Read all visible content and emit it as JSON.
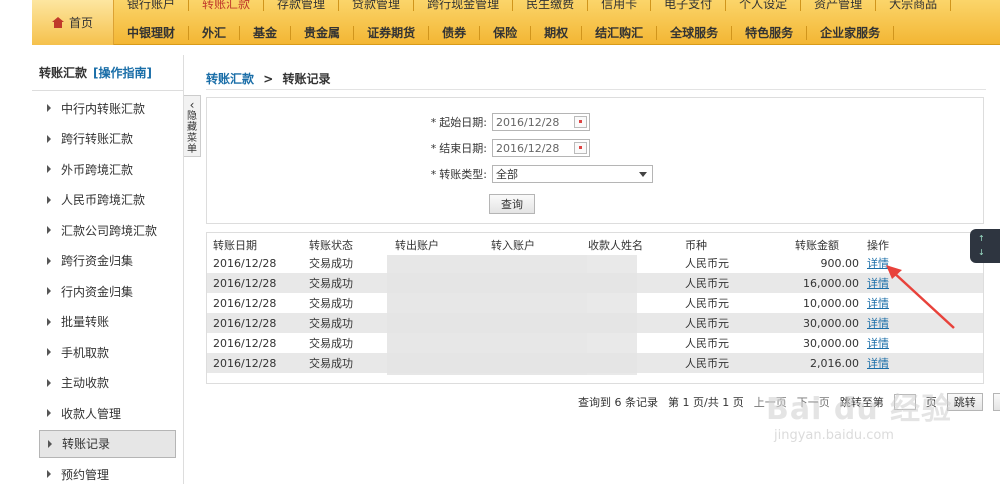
{
  "topnav": {
    "home_label": "首页",
    "row1": [
      "银行账户",
      "转账汇款",
      "存款管理",
      "贷款管理",
      "跨行现金管理",
      "民生缴费",
      "信用卡",
      "电子支付",
      "个人设定",
      "资产管理",
      "大宗商品"
    ],
    "row2": [
      "中银理财",
      "外汇",
      "基金",
      "贵金属",
      "证券期货",
      "债券",
      "保险",
      "期权",
      "结汇购汇",
      "全球服务",
      "特色服务",
      "企业家服务"
    ],
    "active": "转账汇款"
  },
  "sidebar": {
    "title": "转账汇款",
    "guide": "[操作指南]",
    "items": [
      "中行内转账汇款",
      "跨行转账汇款",
      "外币跨境汇款",
      "人民币跨境汇款",
      "汇款公司跨境汇款",
      "跨行资金归集",
      "行内资金归集",
      "批量转账",
      "手机取款",
      "主动收款",
      "收款人管理",
      "转账记录",
      "预约管理"
    ],
    "active": "转账记录"
  },
  "collapse_tab": {
    "chevron": "‹",
    "label": [
      "隐",
      "藏",
      "菜",
      "单"
    ]
  },
  "breadcrumb": {
    "parent": "转账汇款",
    "sep": ">",
    "current": "转账记录"
  },
  "form": {
    "start_label": "起始日期:",
    "start_value": "2016/12/28",
    "end_label": "结束日期:",
    "end_value": "2016/12/28",
    "type_label": "转账类型:",
    "type_value": "全部",
    "query_button": "查询"
  },
  "table": {
    "headers": [
      "转账日期",
      "转账状态",
      "转出账户",
      "转入账户",
      "收款人姓名",
      "币种",
      "转账金额",
      "操作"
    ],
    "rows": [
      {
        "date": "2016/12/28",
        "status": "交易成功",
        "currency": "人民币元",
        "amount": "900.00",
        "op": "详情"
      },
      {
        "date": "2016/12/28",
        "status": "交易成功",
        "currency": "人民币元",
        "amount": "16,000.00",
        "op": "详情"
      },
      {
        "date": "2016/12/28",
        "status": "交易成功",
        "currency": "人民币元",
        "amount": "10,000.00",
        "op": "详情"
      },
      {
        "date": "2016/12/28",
        "status": "交易成功",
        "currency": "人民币元",
        "amount": "30,000.00",
        "op": "详情"
      },
      {
        "date": "2016/12/28",
        "status": "交易成功",
        "currency": "人民币元",
        "amount": "30,000.00",
        "op": "详情"
      },
      {
        "date": "2016/12/28",
        "status": "交易成功",
        "currency": "人民币元",
        "amount": "2,016.00",
        "op": "详情"
      }
    ]
  },
  "pager": {
    "summary": "查询到 6 条记录",
    "pages": "第 1 页/共 1 页",
    "prev": "上一页",
    "next": "下一页",
    "jump_label": "跳转至第",
    "page_unit": "页",
    "jump_button": "跳转",
    "download_button": "下载"
  },
  "watermark": {
    "logo": "Bai du 经验",
    "url": "jingyan.baidu.com"
  },
  "colors": {
    "nav_bg": "#f3b634",
    "link": "#1a6ea8",
    "active_nav": "#c0392b",
    "arrow": "#e8423b"
  }
}
